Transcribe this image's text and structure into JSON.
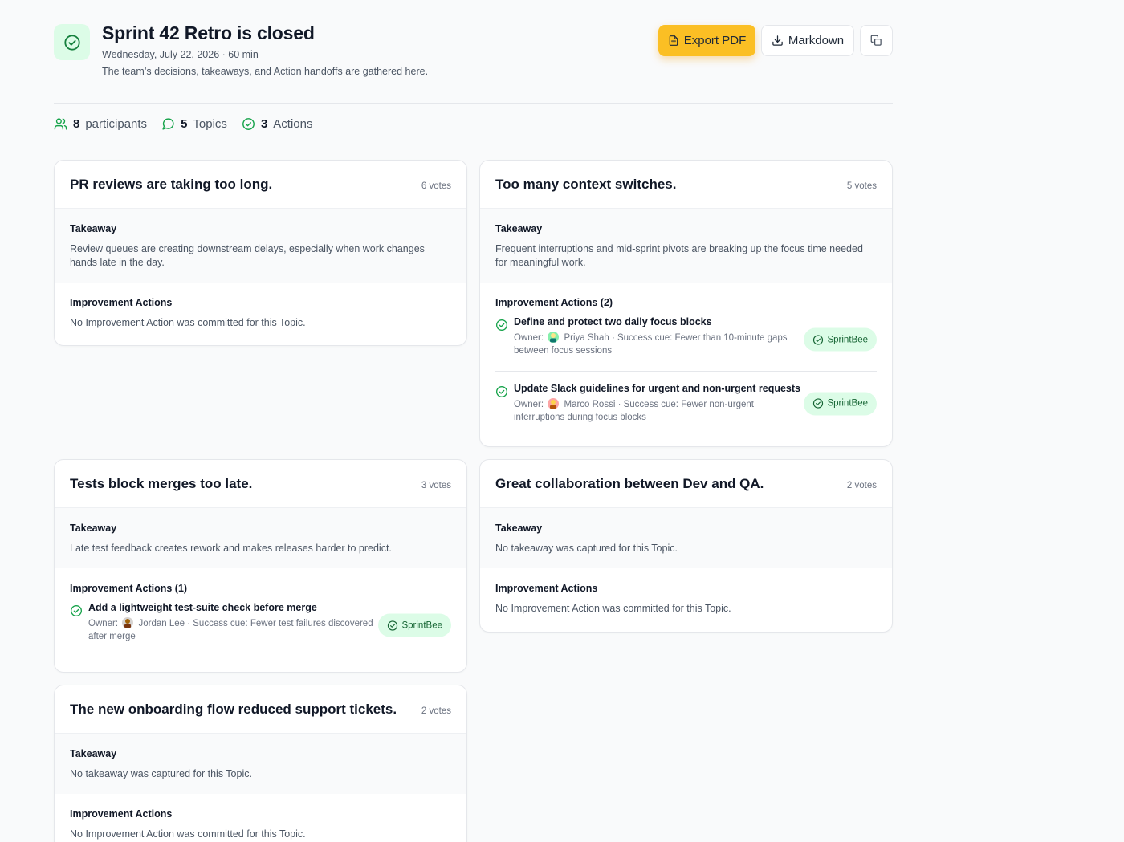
{
  "header": {
    "title": "Sprint 42 Retro is closed",
    "meta": "Wednesday, July 22, 2026 · 60 min",
    "subtitle": "The team’s decisions, takeaways, and Action handoffs are gathered here.",
    "export_pdf_label": "Export PDF",
    "markdown_label": "Markdown"
  },
  "stats": {
    "participants_count": "8",
    "participants_label": "participants",
    "topics_count": "5",
    "topics_label": "Topics",
    "actions_count": "3",
    "actions_label": "Actions"
  },
  "labels": {
    "takeaway": "Takeaway",
    "owner": "Owner:"
  },
  "topics": [
    {
      "title": "PR reviews are taking too long.",
      "votes": "6 votes",
      "takeaway": "Review queues are creating downstream delays, especially when work changes hands late in the day.",
      "actions_heading": "Improvement Actions",
      "empty_actions": "No Improvement Action was committed for this Topic."
    },
    {
      "title": "Too many context switches.",
      "votes": "5 votes",
      "takeaway": "Frequent interruptions and mid-sprint pivots are breaking up the focus time needed for meaningful work.",
      "actions_heading": "Improvement Actions (2)",
      "actions": [
        {
          "title": "Define and protect two daily focus blocks",
          "owner": "Priya Shah",
          "cue": " · Success cue: Fewer than 10-minute gaps between focus sessions",
          "badge": "SprintBee"
        },
        {
          "title": "Update Slack guidelines for urgent and non-urgent requests",
          "owner": "Marco Rossi",
          "cue": " · Success cue: Fewer non-urgent interruptions during focus blocks",
          "badge": "SprintBee"
        }
      ]
    },
    {
      "title": "Tests block merges too late.",
      "votes": "3 votes",
      "takeaway": "Late test feedback creates rework and makes releases harder to predict.",
      "actions_heading": "Improvement Actions (1)",
      "actions": [
        {
          "title": "Add a lightweight test-suite check before merge",
          "owner": "Jordan Lee",
          "cue": " · Success cue: Fewer test failures discovered after merge",
          "badge": "SprintBee"
        }
      ]
    },
    {
      "title": "Great collaboration between Dev and QA.",
      "votes": "2 votes",
      "takeaway": "No takeaway was captured for this Topic.",
      "actions_heading": "Improvement Actions",
      "empty_actions": "No Improvement Action was committed for this Topic."
    },
    {
      "title": "The new onboarding flow reduced support tickets.",
      "votes": "2 votes",
      "takeaway": "No takeaway was captured for this Topic.",
      "actions_heading": "Improvement Actions",
      "empty_actions": "No Improvement Action was committed for this Topic."
    }
  ],
  "colors": {
    "accent_green": "#16a34a",
    "badge_bg": "#dcfce7",
    "export_button": "#fbbf24"
  }
}
